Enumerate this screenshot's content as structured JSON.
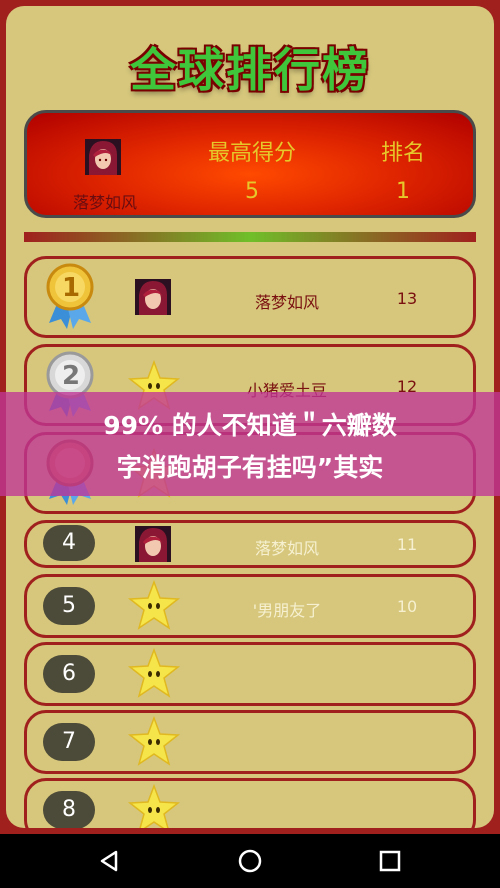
{
  "title": "全球排行榜",
  "me": {
    "name": "落梦如风",
    "score_header": "最高得分",
    "rank_header": "排名",
    "score": "5",
    "rank": "1"
  },
  "rows": [
    {
      "rank": "1",
      "name": "落梦如风",
      "score": "13",
      "badge": "gold-medal",
      "avatar": "player-avatar"
    },
    {
      "rank": "2",
      "name": "小猪爱土豆",
      "score": "12",
      "badge": "silver-medal",
      "avatar": "star-avatar"
    },
    {
      "rank": "3",
      "name": "",
      "score": "",
      "badge": "bronze-medal",
      "avatar": "star-avatar"
    },
    {
      "rank": "4",
      "name": "落梦如风",
      "score": "11",
      "badge": "pill",
      "avatar": "player-avatar"
    },
    {
      "rank": "5",
      "name": "'男朋友了",
      "score": "10",
      "badge": "pill",
      "avatar": "star-avatar"
    },
    {
      "rank": "6",
      "name": "",
      "score": "",
      "badge": "pill",
      "avatar": "star-avatar"
    },
    {
      "rank": "7",
      "name": "",
      "score": "",
      "badge": "pill",
      "avatar": "star-avatar"
    },
    {
      "rank": "8",
      "name": "",
      "score": "",
      "badge": "pill",
      "avatar": "star-avatar"
    }
  ],
  "banner": {
    "line1": "99% 的人不知道＂六瓣数",
    "line2": "字消跑胡子有挂吗”其实"
  },
  "nav": {
    "back": "back-icon",
    "home": "home-icon",
    "recent": "recent-apps-icon"
  }
}
